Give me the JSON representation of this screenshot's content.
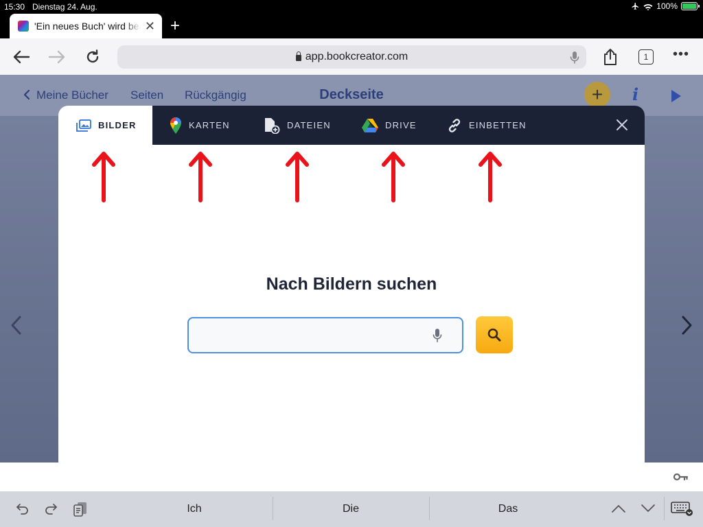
{
  "status": {
    "time": "15:30",
    "date": "Dienstag 24. Aug.",
    "battery": "100%"
  },
  "browser": {
    "tab_title": "'Ein neues Buch' wird bearbeitet",
    "url": "app.bookcreator.com",
    "tab_count": "1"
  },
  "app": {
    "nav_back": "Meine Bücher",
    "nav_pages": "Seiten",
    "nav_undo": "Rückgängig",
    "title": "Deckseite",
    "plus": "+",
    "info": "i"
  },
  "modal": {
    "tabs": [
      {
        "label": "BILDER",
        "icon": "images-icon",
        "active": true
      },
      {
        "label": "KARTEN",
        "icon": "map-pin-icon",
        "active": false
      },
      {
        "label": "DATEIEN",
        "icon": "file-add-icon",
        "active": false
      },
      {
        "label": "DRIVE",
        "icon": "drive-icon",
        "active": false
      },
      {
        "label": "EINBETTEN",
        "icon": "link-icon",
        "active": false
      }
    ],
    "heading": "Nach Bildern suchen",
    "search_value": ""
  },
  "keyboard": {
    "suggestions": [
      "Ich",
      "Die",
      "Das"
    ]
  },
  "colors": {
    "annotation_arrow": "#e8131b",
    "modal_tabbar": "#1c2236",
    "search_button": "#fbb823",
    "accent_blue": "#2f4fa8"
  }
}
